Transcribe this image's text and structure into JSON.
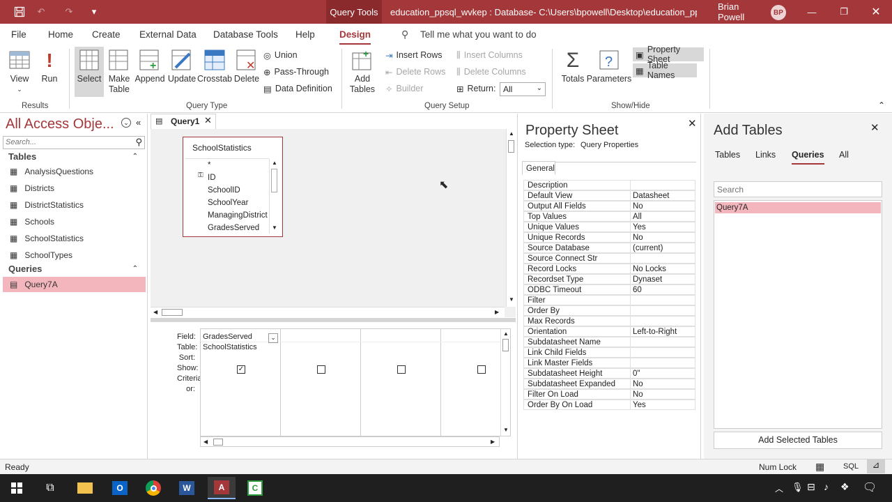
{
  "titlebar": {
    "context_tab": "Query Tools",
    "title": "education_ppsql_wvkep : Database- C:\\Users\\bpowell\\Desktop\\education_ppsql_...",
    "user_name": "Brian Powell",
    "user_initials": "BP"
  },
  "tabs": [
    "File",
    "Home",
    "Create",
    "External Data",
    "Database Tools",
    "Help",
    "Design"
  ],
  "active_tab": "Design",
  "tell_me": "Tell me what you want to do",
  "ribbon": {
    "results": {
      "label": "Results",
      "view": "View",
      "run": "Run"
    },
    "query_type": {
      "label": "Query Type",
      "select": "Select",
      "make_table_1": "Make",
      "make_table_2": "Table",
      "append": "Append",
      "update": "Update",
      "crosstab": "Crosstab",
      "delete": "Delete",
      "union": "Union",
      "pass_through": "Pass-Through",
      "data_definition": "Data Definition"
    },
    "query_setup": {
      "label": "Query Setup",
      "add_tables_1": "Add",
      "add_tables_2": "Tables",
      "insert_rows": "Insert Rows",
      "delete_rows": "Delete Rows",
      "builder": "Builder",
      "insert_columns": "Insert Columns",
      "delete_columns": "Delete Columns",
      "return_label": "Return:",
      "return_value": "All"
    },
    "show_hide": {
      "label": "Show/Hide",
      "totals": "Totals",
      "parameters": "Parameters",
      "property_sheet": "Property Sheet",
      "table_names": "Table Names"
    }
  },
  "nav": {
    "title": "All Access Obje...",
    "search_placeholder": "Search...",
    "tables_header": "Tables",
    "tables": [
      "AnalysisQuestions",
      "Districts",
      "DistrictStatistics",
      "Schools",
      "SchoolStatistics",
      "SchoolTypes"
    ],
    "queries_header": "Queries",
    "queries": [
      "Query7A"
    ]
  },
  "doc_tab": "Query1",
  "table_box": {
    "title": "SchoolStatistics",
    "fields": [
      "*",
      "ID",
      "SchoolID",
      "SchoolYear",
      "ManagingDistrict",
      "GradesServed"
    ]
  },
  "grid": {
    "row_labels": [
      "Field:",
      "Table:",
      "Sort:",
      "Show:",
      "Criteria:",
      "or:"
    ],
    "field": "GradesServed",
    "table": "SchoolStatistics"
  },
  "property_sheet": {
    "title": "Property Sheet",
    "selection_type_label": "Selection type:",
    "selection_type": "Query Properties",
    "tab": "General",
    "rows": [
      {
        "name": "Description",
        "value": ""
      },
      {
        "name": "Default View",
        "value": "Datasheet"
      },
      {
        "name": "Output All Fields",
        "value": "No"
      },
      {
        "name": "Top Values",
        "value": "All"
      },
      {
        "name": "Unique Values",
        "value": "Yes"
      },
      {
        "name": "Unique Records",
        "value": "No"
      },
      {
        "name": "Source Database",
        "value": "(current)"
      },
      {
        "name": "Source Connect Str",
        "value": ""
      },
      {
        "name": "Record Locks",
        "value": "No Locks"
      },
      {
        "name": "Recordset Type",
        "value": "Dynaset"
      },
      {
        "name": "ODBC Timeout",
        "value": "60"
      },
      {
        "name": "Filter",
        "value": ""
      },
      {
        "name": "Order By",
        "value": ""
      },
      {
        "name": "Max Records",
        "value": ""
      },
      {
        "name": "Orientation",
        "value": "Left-to-Right"
      },
      {
        "name": "Subdatasheet Name",
        "value": ""
      },
      {
        "name": "Link Child Fields",
        "value": ""
      },
      {
        "name": "Link Master Fields",
        "value": ""
      },
      {
        "name": "Subdatasheet Height",
        "value": "0\""
      },
      {
        "name": "Subdatasheet Expanded",
        "value": "No"
      },
      {
        "name": "Filter On Load",
        "value": "No"
      },
      {
        "name": "Order By On Load",
        "value": "Yes"
      }
    ]
  },
  "add_tables": {
    "title": "Add Tables",
    "tabs": [
      "Tables",
      "Links",
      "Queries",
      "All"
    ],
    "active_tab": "Queries",
    "search_placeholder": "Search",
    "items": [
      "Query7A"
    ],
    "button": "Add Selected Tables"
  },
  "status": {
    "text": "Ready",
    "num_lock": "Num Lock",
    "sql": "SQL"
  },
  "colors": {
    "accent": "#a4373a",
    "selection": "#f4b6bd"
  }
}
